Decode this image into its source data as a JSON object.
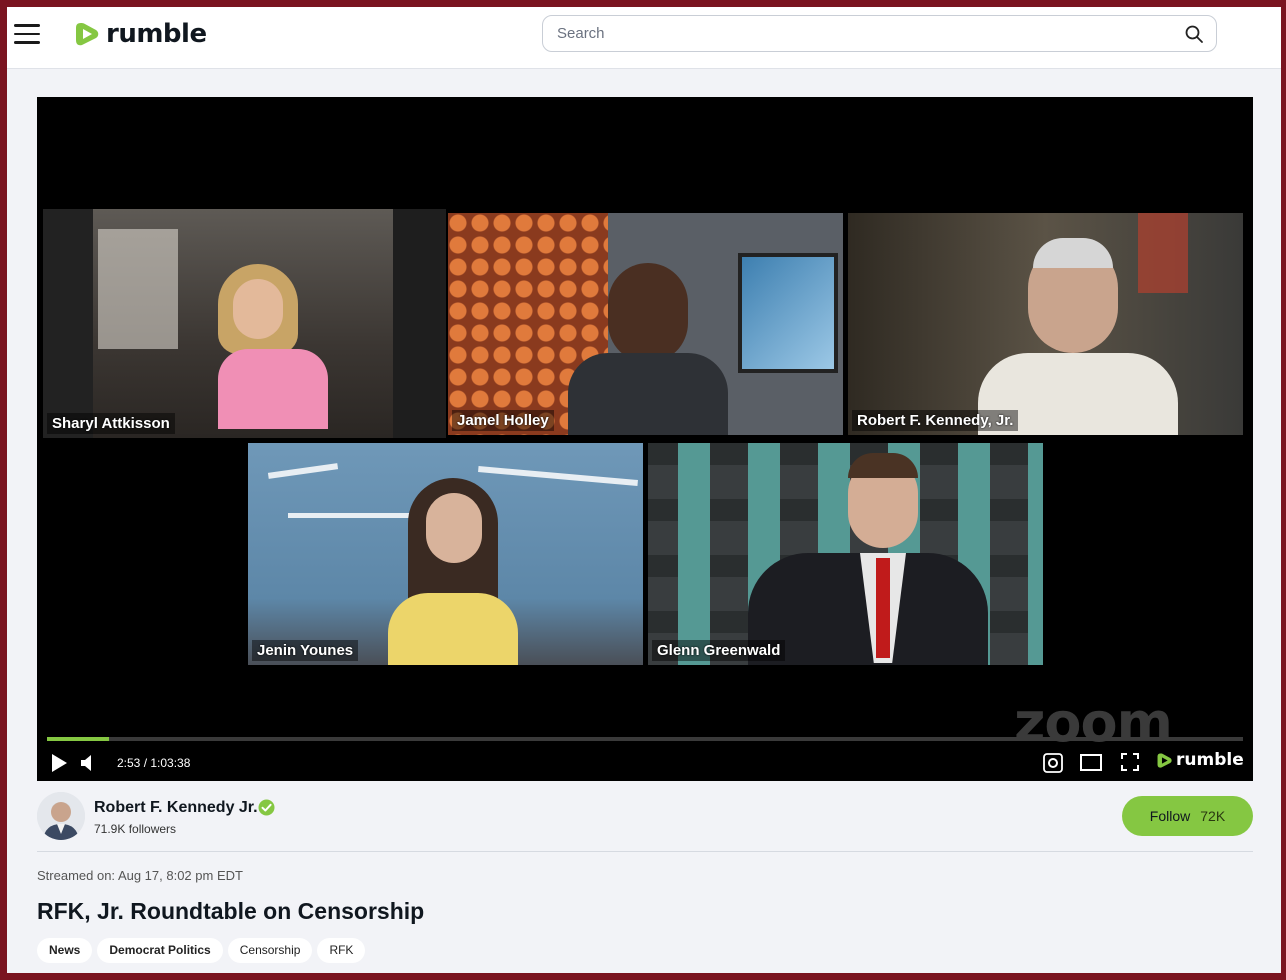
{
  "header": {
    "logo_text": "rumble",
    "search_placeholder": "Search"
  },
  "player": {
    "participants": [
      {
        "name": "Sharyl Attkisson"
      },
      {
        "name": "Jamel Holley"
      },
      {
        "name": "Robert F. Kennedy, Jr."
      },
      {
        "name": "Jenin Younes"
      },
      {
        "name": "Glenn Greenwald"
      }
    ],
    "watermark": "zoom",
    "time": "2:53 / 1:03:38",
    "progress_fraction": 0.052,
    "logo_text": "rumble"
  },
  "channel": {
    "name": "Robert F. Kennedy Jr.",
    "followers": "71.9K followers",
    "follow_label": "Follow",
    "follow_count": "72K"
  },
  "video": {
    "streamed": "Streamed on: Aug 17, 8:02 pm EDT",
    "title": "RFK, Jr. Roundtable on Censorship",
    "tags": [
      "News",
      "Democrat Politics",
      "Censorship",
      "RFK"
    ]
  },
  "colors": {
    "accent": "#85c742",
    "border": "#7a1420"
  }
}
